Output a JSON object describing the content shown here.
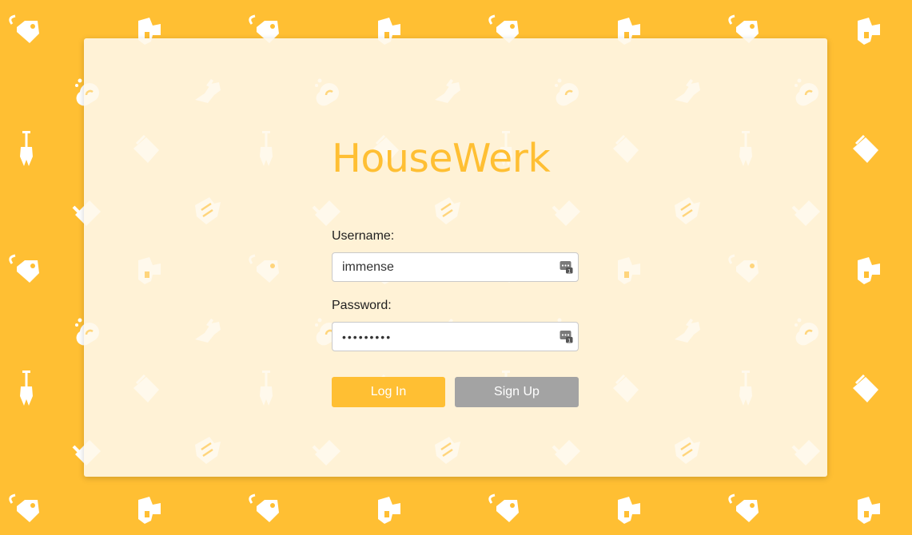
{
  "app": {
    "brand": "HouseWerk",
    "brand_color": "#ffbf33",
    "background_color": "#ffbf33",
    "card_color": "#fff2d6"
  },
  "login_form": {
    "username_label": "Username:",
    "username_value": "immense",
    "password_label": "Password:",
    "password_value": "immense12",
    "login_button": "Log In",
    "signup_button": "Sign Up",
    "signup_color": "#a3a3a3",
    "autofill_icon": "password-manager-key-icon"
  },
  "background_icons": [
    "tag-icon",
    "paint-roller-icon",
    "spray-bottle-icon",
    "sponge-icon",
    "broom-icon",
    "bucket-icon",
    "rubber-glove-icon",
    "mop-icon"
  ]
}
